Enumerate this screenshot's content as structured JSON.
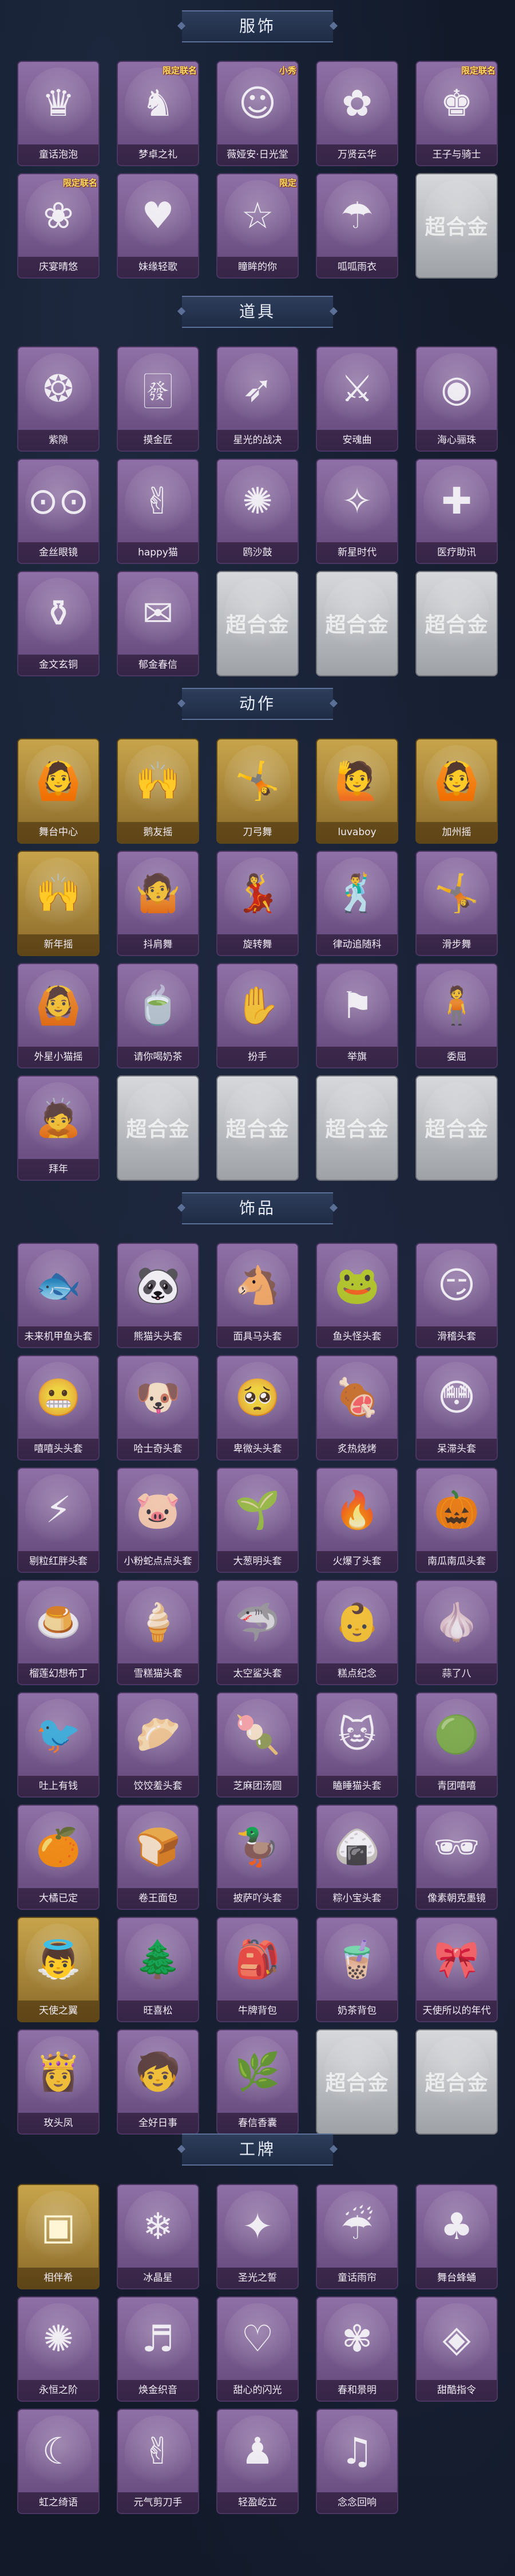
{
  "sections": [
    {
      "title": "服饰",
      "items": [
        {
          "name": "童话泡泡",
          "icon": "princess-doll-icon",
          "glyph": "♛",
          "style": "purple"
        },
        {
          "name": "梦卓之礼",
          "icon": "dark-knight-icon",
          "glyph": "♞",
          "style": "purple",
          "tag": "限定联名"
        },
        {
          "name": "薇娅安·日光堂",
          "icon": "girl-hood-icon",
          "glyph": "☺",
          "style": "purple",
          "tag": "小秀"
        },
        {
          "name": "万贤云华",
          "icon": "silver-hair-icon",
          "glyph": "✿",
          "style": "purple"
        },
        {
          "name": "王子与骑士",
          "icon": "prince-icon",
          "glyph": "♚",
          "style": "purple",
          "tag": "限定联名"
        },
        {
          "name": "庆宴晴悠",
          "icon": "party-girl-icon",
          "glyph": "❀",
          "style": "purple",
          "tag": "限定联名"
        },
        {
          "name": "妹缘轻歌",
          "icon": "pink-hair-icon",
          "glyph": "♥",
          "style": "purple"
        },
        {
          "name": "瞳眸的你",
          "icon": "witch-hat-icon",
          "glyph": "☆",
          "style": "purple",
          "tag": "限定"
        },
        {
          "name": "呱呱雨衣",
          "icon": "frog-raincoat-icon",
          "glyph": "☂",
          "style": "purple"
        },
        {
          "name": "超合金",
          "icon": "placeholder-logo-icon",
          "glyph": "超合金",
          "style": "blank"
        }
      ]
    },
    {
      "title": "道具",
      "items": [
        {
          "name": "紫隙",
          "icon": "pendant-icon",
          "glyph": "❂",
          "style": "purple"
        },
        {
          "name": "摸金匠",
          "icon": "mahjong-tile-icon",
          "glyph": "🀅",
          "style": "purple"
        },
        {
          "name": "星光的战决",
          "icon": "rifle-icon",
          "glyph": "➶",
          "style": "purple"
        },
        {
          "name": "安魂曲",
          "icon": "red-gun-icon",
          "glyph": "⚔",
          "style": "purple"
        },
        {
          "name": "海心骊珠",
          "icon": "pearl-shell-icon",
          "glyph": "◉",
          "style": "purple"
        },
        {
          "name": "金丝眼镜",
          "icon": "glasses-icon",
          "glyph": "⊙⊙",
          "style": "purple"
        },
        {
          "name": "happy猫",
          "icon": "cat-icon",
          "glyph": "✌",
          "style": "purple"
        },
        {
          "name": "鸥沙鼓",
          "icon": "drum-icon",
          "glyph": "✺",
          "style": "purple"
        },
        {
          "name": "新星时代",
          "icon": "revolver-icon",
          "glyph": "✧",
          "style": "purple"
        },
        {
          "name": "医疗助讯",
          "icon": "medkit-icon",
          "glyph": "✚",
          "style": "purple"
        },
        {
          "name": "金文玄铜",
          "icon": "lantern-icon",
          "glyph": "⚱",
          "style": "purple"
        },
        {
          "name": "郁金春信",
          "icon": "bag-icon",
          "glyph": "✉",
          "style": "purple"
        },
        {
          "name": "超合金",
          "icon": "placeholder-logo-icon",
          "glyph": "超合金",
          "style": "blank"
        },
        {
          "name": "超合金",
          "icon": "placeholder-logo-icon",
          "glyph": "超合金",
          "style": "blank"
        },
        {
          "name": "超合金",
          "icon": "placeholder-logo-icon",
          "glyph": "超合金",
          "style": "blank"
        }
      ]
    },
    {
      "title": "动作",
      "items": [
        {
          "name": "舞台中心",
          "icon": "pose-figure-icon",
          "glyph": "🙆",
          "style": "gold"
        },
        {
          "name": "鹅友摇",
          "icon": "pose-figure-icon",
          "glyph": "🙌",
          "style": "gold"
        },
        {
          "name": "刀弓舞",
          "icon": "pose-figure-icon",
          "glyph": "🤸",
          "style": "gold"
        },
        {
          "name": "luvaboy",
          "icon": "pose-figure-icon",
          "glyph": "🙋",
          "style": "gold"
        },
        {
          "name": "加州摇",
          "icon": "pose-figure-icon",
          "glyph": "🙆",
          "style": "gold"
        },
        {
          "name": "新年摇",
          "icon": "pose-figure-icon",
          "glyph": "🙌",
          "style": "gold"
        },
        {
          "name": "抖肩舞",
          "icon": "pose-figure-icon",
          "glyph": "🤷",
          "style": "purple"
        },
        {
          "name": "旋转舞",
          "icon": "pose-figure-icon",
          "glyph": "💃",
          "style": "purple"
        },
        {
          "name": "律动追随科",
          "icon": "pose-figure-icon",
          "glyph": "🕺",
          "style": "purple"
        },
        {
          "name": "滑步舞",
          "icon": "pose-figure-icon",
          "glyph": "🤸",
          "style": "purple"
        },
        {
          "name": "外星小猫摇",
          "icon": "pose-figure-icon",
          "glyph": "🙆",
          "style": "purple"
        },
        {
          "name": "请你喝奶茶",
          "icon": "pose-figure-icon",
          "glyph": "🍵",
          "style": "purple"
        },
        {
          "name": "扮手",
          "icon": "pose-figure-icon",
          "glyph": "✋",
          "style": "purple"
        },
        {
          "name": "举旗",
          "icon": "pose-figure-icon",
          "glyph": "⚑",
          "style": "purple"
        },
        {
          "name": "委屈",
          "icon": "pose-figure-icon",
          "glyph": "🧍",
          "style": "purple"
        },
        {
          "name": "拜年",
          "icon": "pose-figure-icon",
          "glyph": "🙇",
          "style": "purple"
        },
        {
          "name": "超合金",
          "icon": "placeholder-logo-icon",
          "glyph": "超合金",
          "style": "blank"
        },
        {
          "name": "超合金",
          "icon": "placeholder-logo-icon",
          "glyph": "超合金",
          "style": "blank"
        },
        {
          "name": "超合金",
          "icon": "placeholder-logo-icon",
          "glyph": "超合金",
          "style": "blank"
        },
        {
          "name": "超合金",
          "icon": "placeholder-logo-icon",
          "glyph": "超合金",
          "style": "blank"
        }
      ]
    },
    {
      "title": "饰品",
      "items": [
        {
          "name": "未来机甲鱼头套",
          "icon": "fish-mask-icon",
          "glyph": "🐟",
          "style": "purple"
        },
        {
          "name": "熊猫头头套",
          "icon": "panda-mask-icon",
          "glyph": "🐼",
          "style": "purple"
        },
        {
          "name": "面具马头套",
          "icon": "horse-mask-icon",
          "glyph": "🐴",
          "style": "purple"
        },
        {
          "name": "鱼头怪头套",
          "icon": "fish-head-mask-icon",
          "glyph": "🐸",
          "style": "purple"
        },
        {
          "name": "滑稽头套",
          "icon": "smiley-mask-icon",
          "glyph": "😏",
          "style": "purple"
        },
        {
          "name": "嘻嘻头头套",
          "icon": "grin-mask-icon",
          "glyph": "😬",
          "style": "purple"
        },
        {
          "name": "哈士奇头套",
          "icon": "husky-mask-icon",
          "glyph": "🐶",
          "style": "purple"
        },
        {
          "name": "卑微头头套",
          "icon": "sad-mask-icon",
          "glyph": "🥺",
          "style": "purple"
        },
        {
          "name": "炙热烧烤",
          "icon": "bbq-mask-icon",
          "glyph": "🍖",
          "style": "purple"
        },
        {
          "name": "呆滞头套",
          "icon": "dazed-mask-icon",
          "glyph": "😳",
          "style": "purple"
        },
        {
          "name": "剔粒红胖头套",
          "icon": "pikachu-mask-icon",
          "glyph": "⚡",
          "style": "purple"
        },
        {
          "name": "小粉蛇点点头套",
          "icon": "pig-mask-icon",
          "glyph": "🐷",
          "style": "purple"
        },
        {
          "name": "大葱明头套",
          "icon": "scallion-mask-icon",
          "glyph": "🌱",
          "style": "purple"
        },
        {
          "name": "火爆了头套",
          "icon": "fire-mask-icon",
          "glyph": "🔥",
          "style": "purple"
        },
        {
          "name": "南瓜南瓜头套",
          "icon": "pumpkin-mask-icon",
          "glyph": "🎃",
          "style": "purple"
        },
        {
          "name": "榴莲幻想布丁",
          "icon": "pudding-mask-icon",
          "glyph": "🍮",
          "style": "purple"
        },
        {
          "name": "雪糕猫头套",
          "icon": "icecream-mask-icon",
          "glyph": "🍦",
          "style": "purple"
        },
        {
          "name": "太空鲨头套",
          "icon": "shark-mask-icon",
          "glyph": "🦈",
          "style": "purple"
        },
        {
          "name": "糕点纪念",
          "icon": "baby-mask-icon",
          "glyph": "👶",
          "style": "purple"
        },
        {
          "name": "蒜了八",
          "icon": "garlic-mask-icon",
          "glyph": "🧄",
          "style": "purple"
        },
        {
          "name": "吐上有钱",
          "icon": "bird-mask-icon",
          "glyph": "🐦",
          "style": "purple"
        },
        {
          "name": "饺饺羞头套",
          "icon": "dumpling-mask-icon",
          "glyph": "🥟",
          "style": "purple"
        },
        {
          "name": "芝麻团汤圆",
          "icon": "dango-mask-icon",
          "glyph": "🍡",
          "style": "purple"
        },
        {
          "name": "瞌睡猫头套",
          "icon": "sleepy-cat-mask-icon",
          "glyph": "🐱",
          "style": "purple"
        },
        {
          "name": "青团嘻嘻",
          "icon": "green-ball-mask-icon",
          "glyph": "🟢",
          "style": "purple"
        },
        {
          "name": "大橘已定",
          "icon": "orange-mask-icon",
          "glyph": "🍊",
          "style": "purple"
        },
        {
          "name": "卷王面包",
          "icon": "bread-mask-icon",
          "glyph": "🍞",
          "style": "purple"
        },
        {
          "name": "披萨吖头套",
          "icon": "duck-mask-icon",
          "glyph": "🦆",
          "style": "purple"
        },
        {
          "name": "粽小宝头套",
          "icon": "zongzi-mask-icon",
          "glyph": "🍙",
          "style": "purple"
        },
        {
          "name": "像素朝克墨镜",
          "icon": "sunglasses-icon",
          "glyph": "🕶",
          "style": "purple"
        },
        {
          "name": "天使之翼",
          "icon": "angel-wings-icon",
          "glyph": "👼",
          "style": "gold"
        },
        {
          "name": "旺喜松",
          "icon": "bonsai-icon",
          "glyph": "🌲",
          "style": "purple"
        },
        {
          "name": "牛牌背包",
          "icon": "backpack-icon",
          "glyph": "🎒",
          "style": "purple"
        },
        {
          "name": "奶茶背包",
          "icon": "milktea-bag-icon",
          "glyph": "🧋",
          "style": "purple"
        },
        {
          "name": "天使所以的年代",
          "icon": "girl-doll-icon",
          "glyph": "🎀",
          "style": "purple"
        },
        {
          "name": "玫头凤",
          "icon": "phoenix-doll-icon",
          "glyph": "👸",
          "style": "purple"
        },
        {
          "name": "全好日事",
          "icon": "boy-doll-icon",
          "glyph": "🧒",
          "style": "purple"
        },
        {
          "name": "春信香囊",
          "icon": "sachet-icon",
          "glyph": "🌿",
          "style": "purple"
        },
        {
          "name": "超合金",
          "icon": "placeholder-logo-icon",
          "glyph": "超合金",
          "style": "blank"
        },
        {
          "name": "超合金",
          "icon": "placeholder-logo-icon",
          "glyph": "超合金",
          "style": "blank"
        }
      ]
    },
    {
      "title": "工牌",
      "items": [
        {
          "name": "相伴希",
          "icon": "badge-card-icon",
          "glyph": "▣",
          "style": "gold"
        },
        {
          "name": "冰晶星",
          "icon": "badge-card-icon",
          "glyph": "❄",
          "style": "purple"
        },
        {
          "name": "圣光之誓",
          "icon": "badge-card-icon",
          "glyph": "✦",
          "style": "purple"
        },
        {
          "name": "童话雨帘",
          "icon": "badge-card-icon",
          "glyph": "☔",
          "style": "purple"
        },
        {
          "name": "舞台蜂蛹",
          "icon": "badge-card-icon",
          "glyph": "♣",
          "style": "purple"
        },
        {
          "name": "永恒之阶",
          "icon": "badge-card-icon",
          "glyph": "✺",
          "style": "purple"
        },
        {
          "name": "焕金织音",
          "icon": "badge-card-icon",
          "glyph": "♬",
          "style": "purple"
        },
        {
          "name": "甜心的闪光",
          "icon": "badge-card-icon",
          "glyph": "♡",
          "style": "purple"
        },
        {
          "name": "春和景明",
          "icon": "badge-card-icon",
          "glyph": "✾",
          "style": "purple"
        },
        {
          "name": "甜酷指令",
          "icon": "badge-card-icon",
          "glyph": "◈",
          "style": "purple"
        },
        {
          "name": "虹之绮语",
          "icon": "badge-card-icon",
          "glyph": "☾",
          "style": "purple"
        },
        {
          "name": "元气剪刀手",
          "icon": "badge-card-icon",
          "glyph": "✌",
          "style": "purple"
        },
        {
          "name": "轻盈屹立",
          "icon": "badge-card-icon",
          "glyph": "♟",
          "style": "purple"
        },
        {
          "name": "念念回响",
          "icon": "badge-card-icon",
          "glyph": "♫",
          "style": "purple"
        }
      ]
    }
  ]
}
